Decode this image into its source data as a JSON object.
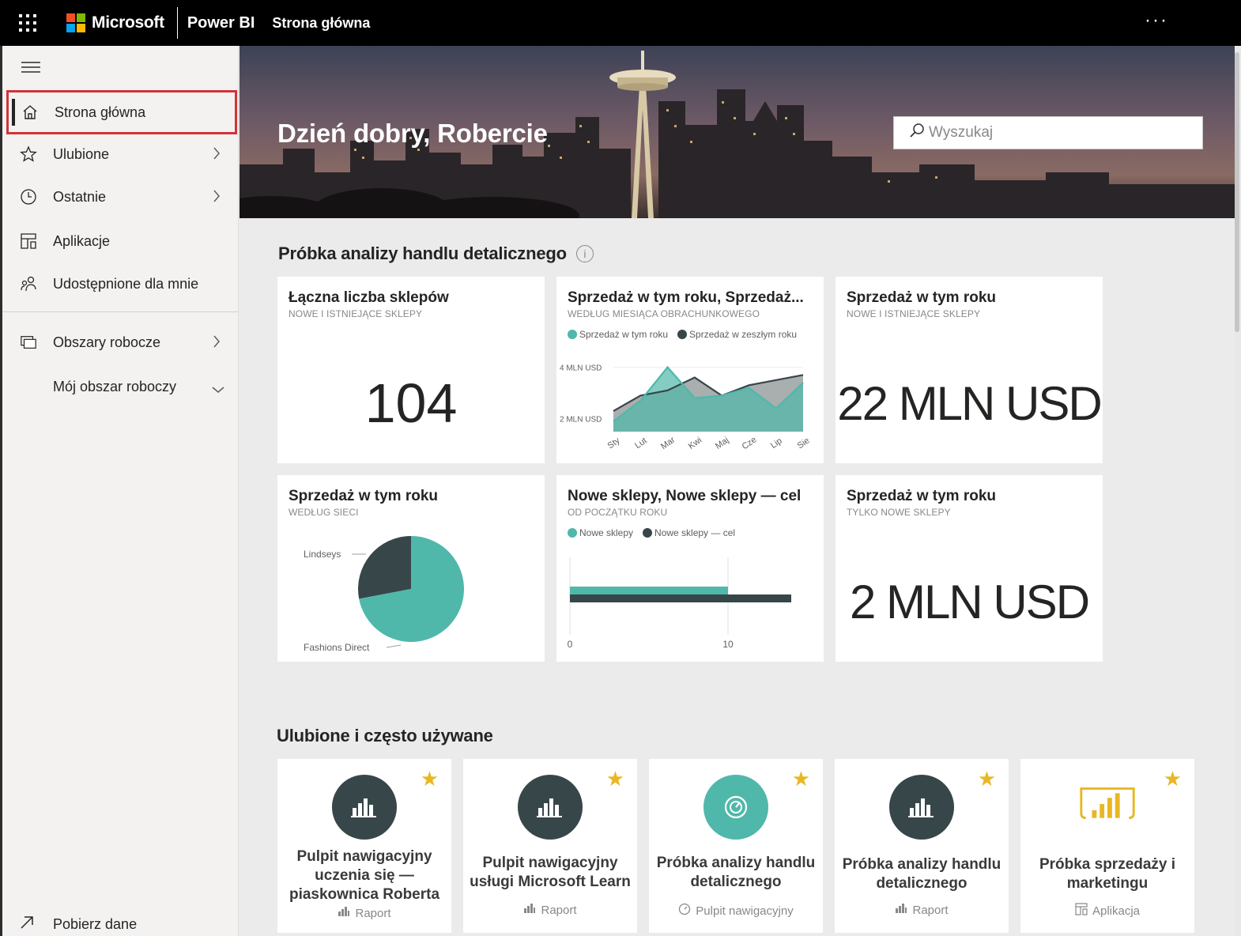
{
  "topbar": {
    "brand": "Microsoft",
    "product": "Power BI",
    "breadcrumb": "Strona główna",
    "more": "···"
  },
  "sidebar": {
    "items": [
      {
        "label": "Strona główna",
        "icon": "home-icon",
        "active": true
      },
      {
        "label": "Ulubione",
        "icon": "star-icon"
      },
      {
        "label": "Ostatnie",
        "icon": "clock-icon"
      },
      {
        "label": "Aplikacje",
        "icon": "apps-icon"
      },
      {
        "label": "Udostępnione dla mnie",
        "icon": "shared-icon"
      },
      {
        "label": "Obszary robocze",
        "icon": "workspaces-icon"
      },
      {
        "label": "Mój obszar roboczy",
        "icon": ""
      }
    ],
    "get_data": "Pobierz dane"
  },
  "hero": {
    "greeting": "Dzień dobry, Robercie",
    "search_placeholder": "Wyszukaj"
  },
  "sample_section": {
    "title": "Próbka analizy handlu detalicznego",
    "info": "i",
    "tiles": [
      {
        "title": "Łączna liczba sklepów",
        "subtitle": "NOWE I ISTNIEJĄCE SKLEPY",
        "value": "104"
      },
      {
        "title": "Sprzedaż w tym roku, Sprzedaż...",
        "subtitle": "WEDŁUG MIESIĄCA OBRACHUNKOWEGO",
        "legend": [
          "Sprzedaż w tym roku",
          "Sprzedaż w zeszłym roku"
        ]
      },
      {
        "title": "Sprzedaż w tym roku",
        "subtitle": "NOWE I ISTNIEJĄCE SKLEPY",
        "value": "22 MLN USD"
      },
      {
        "title": "Sprzedaż w tym roku",
        "subtitle": "WEDŁUG SIECI",
        "pie_labels": [
          "Lindseys",
          "Fashions Direct"
        ]
      },
      {
        "title": "Nowe sklepy, Nowe sklepy — cel",
        "subtitle": "OD POCZĄTKU ROKU",
        "legend": [
          "Nowe sklepy",
          "Nowe sklepy — cel"
        ]
      },
      {
        "title": "Sprzedaż w tym roku",
        "subtitle": "TYLKO NOWE SKLEPY",
        "value": "2 MLN USD"
      }
    ]
  },
  "chart_data": [
    {
      "type": "area",
      "categories": [
        "Sty",
        "Lut",
        "Mar",
        "Kwi",
        "Maj",
        "Cze",
        "Lip",
        "Sie"
      ],
      "series": [
        {
          "name": "Sprzedaż w tym roku",
          "values": [
            1.9,
            2.7,
            4.0,
            2.8,
            2.9,
            3.2,
            2.4,
            3.4
          ],
          "color": "#4fb8aa"
        },
        {
          "name": "Sprzedaż w zeszłym roku",
          "values": [
            2.3,
            2.9,
            3.1,
            3.6,
            2.9,
            3.3,
            3.5,
            3.7
          ],
          "color": "#374649"
        }
      ],
      "yticks": [
        "4 MLN USD",
        "2 MLN USD"
      ],
      "ylim": [
        1.5,
        4.2
      ]
    },
    {
      "type": "pie",
      "slices": [
        {
          "label": "Lindseys",
          "value": 28,
          "color": "#374649"
        },
        {
          "label": "Fashions Direct",
          "value": 72,
          "color": "#4fb8aa"
        }
      ]
    },
    {
      "type": "bar",
      "series": [
        {
          "name": "Nowe sklepy",
          "values": [
            10
          ],
          "color": "#4fb8aa"
        },
        {
          "name": "Nowe sklepy — cel",
          "values": [
            14
          ],
          "color": "#374649"
        }
      ],
      "xticks": [
        "0",
        "10"
      ],
      "xlim": [
        0,
        14
      ]
    }
  ],
  "favorites_section": {
    "title": "Ulubione i często używane",
    "items": [
      {
        "name": "Pulpit nawigacyjny uczenia się — piaskownica Roberta",
        "type": "Raport",
        "icon": "report-icon",
        "color": "#374649"
      },
      {
        "name": "Pulpit nawigacyjny usługi Microsoft Learn",
        "type": "Raport",
        "icon": "report-icon",
        "color": "#374649"
      },
      {
        "name": "Próbka analizy handlu detalicznego",
        "type": "Pulpit nawigacyjny",
        "icon": "dashboard-icon",
        "color": "#4fb8aa"
      },
      {
        "name": "Próbka analizy handlu detalicznego",
        "type": "Raport",
        "icon": "report-icon",
        "color": "#374649"
      },
      {
        "name": "Próbka sprzedaży i marketingu",
        "type": "Aplikacja",
        "icon": "app-icon",
        "color": "#e8b723"
      }
    ]
  },
  "colors": {
    "accent_teal": "#4fb8aa",
    "dark_series": "#374649",
    "highlight_red": "#d13438",
    "favorite_star": "#e8b723"
  }
}
